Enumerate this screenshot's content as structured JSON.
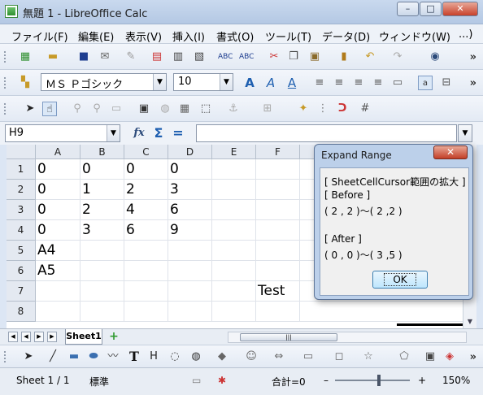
{
  "window": {
    "title": "無題 1 - LibreOffice Calc",
    "minimize": "–",
    "maximize": "□",
    "close": "✕"
  },
  "menu": [
    "ファイル(F)",
    "編集(E)",
    "表示(V)",
    "挿入(I)",
    "書式(O)",
    "ツール(T)",
    "データ(D)",
    "ウィンドウ(W)",
    "...)"
  ],
  "formatting": {
    "font_name": "ＭＳ Ｐゴシック",
    "font_size": "10"
  },
  "formula_bar": {
    "name_box": "H9",
    "function_wizard": "fx",
    "sum": "Σ",
    "equals": "="
  },
  "columns": [
    "A",
    "B",
    "C",
    "D",
    "E",
    "F"
  ],
  "rows": [
    "1",
    "2",
    "3",
    "4",
    "5",
    "6",
    "7",
    "8"
  ],
  "cells": {
    "A1": "0",
    "B1": "0",
    "C1": "0",
    "D1": "0",
    "A2": "0",
    "B2": "1",
    "C2": "2",
    "D2": "3",
    "A3": "0",
    "B3": "2",
    "C3": "4",
    "D3": "6",
    "A4": "0",
    "B4": "3",
    "C4": "6",
    "D4": "9",
    "A5": "A4",
    "A6": "A5",
    "F7": "Test"
  },
  "sheet_tabs": {
    "active": "Sheet1",
    "add": "+"
  },
  "status": {
    "sheet": "Sheet 1 / 1",
    "style": "標準",
    "sum": "合計=0",
    "zoom": "150%",
    "zoom_minus": "–",
    "zoom_plus": "+"
  },
  "dialog": {
    "title": "Expand Range",
    "close": "✕",
    "lines": [
      "[ SheetCellCursor範囲の拡大 ]",
      "[ Before ]",
      "( 2 , 2 )～( 2 ,2 )",
      "",
      "[ After ]",
      "( 0 , 0 )～( 3 ,5 )"
    ],
    "ok": "OK"
  }
}
